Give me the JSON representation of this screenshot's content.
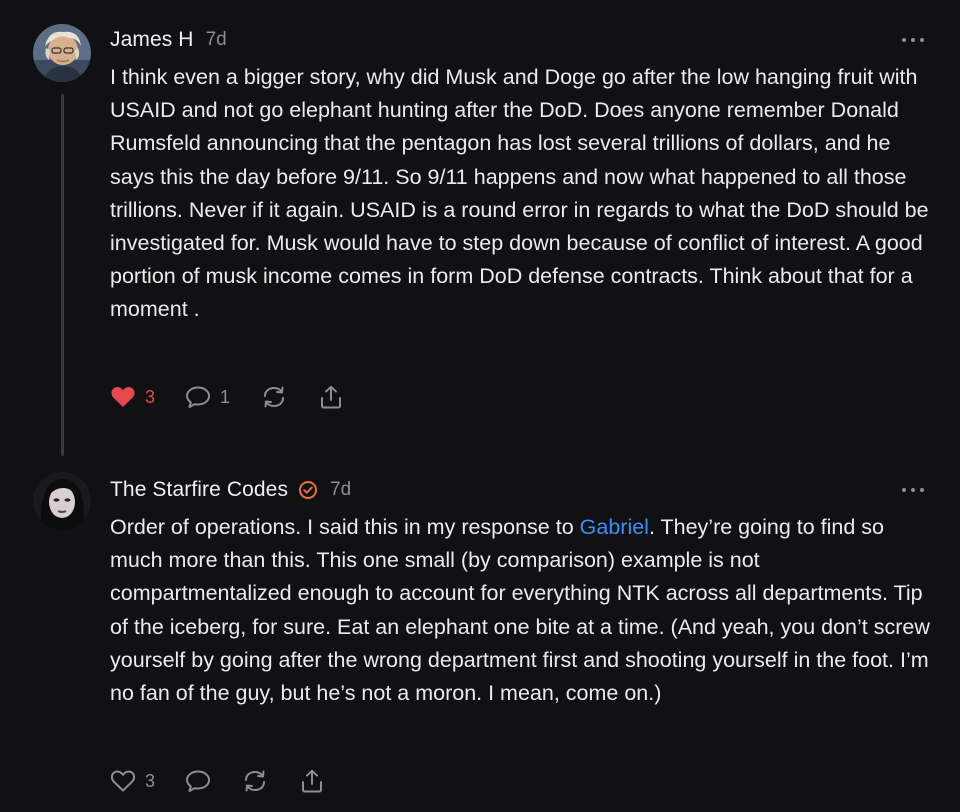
{
  "colors": {
    "background": "#111113",
    "text": "#ebebed",
    "muted": "#8d8d93",
    "link": "#3e8ef7",
    "like_active": "#e5484d",
    "verified": "#e8703a"
  },
  "comments": [
    {
      "author": "James H",
      "time": "7d",
      "body": "I think even a bigger story, why did Musk and Doge go after the low hanging fruit with USAID and not go elephant hunting after the DoD. Does anyone remember Donald Rumsfeld announcing that the pentagon has lost several trillions of dollars, and he says this the day before 9/11. So 9/11 happens and now what happened to all those trillions. Never if it again. USAID is a round error in regards to what the DoD should be investigated for. Musk would have to step down because of conflict of interest. A good portion of musk income comes in form DoD defense contracts. Think about that for a moment .",
      "likes": "3",
      "liked": true,
      "replies": "1",
      "icons": [
        "heart-filled-icon",
        "speech-bubble-icon",
        "restack-icon",
        "share-icon",
        "more-dots-icon"
      ]
    },
    {
      "author": "The Starfire Codes",
      "verified": true,
      "time": "7d",
      "body_before_link": "Order of operations. I said this in my response to ",
      "link_text": "Gabriel",
      "body_after_link": ". They’re going to find so much more than this. This one small (by comparison) example is not compartmentalized enough to account for everything NTK across all departments. Tip of the iceberg, for sure. Eat an elephant one bite at a time. (And yeah, you don’t screw yourself by going after the wrong department first and shooting yourself in the foot. I’m no fan of the guy, but he’s not a moron. I mean, come on.)",
      "likes": "3",
      "liked": false,
      "icons": [
        "heart-outline-icon",
        "speech-bubble-icon",
        "restack-icon",
        "share-icon",
        "verified-check-icon",
        "more-dots-icon"
      ]
    }
  ]
}
